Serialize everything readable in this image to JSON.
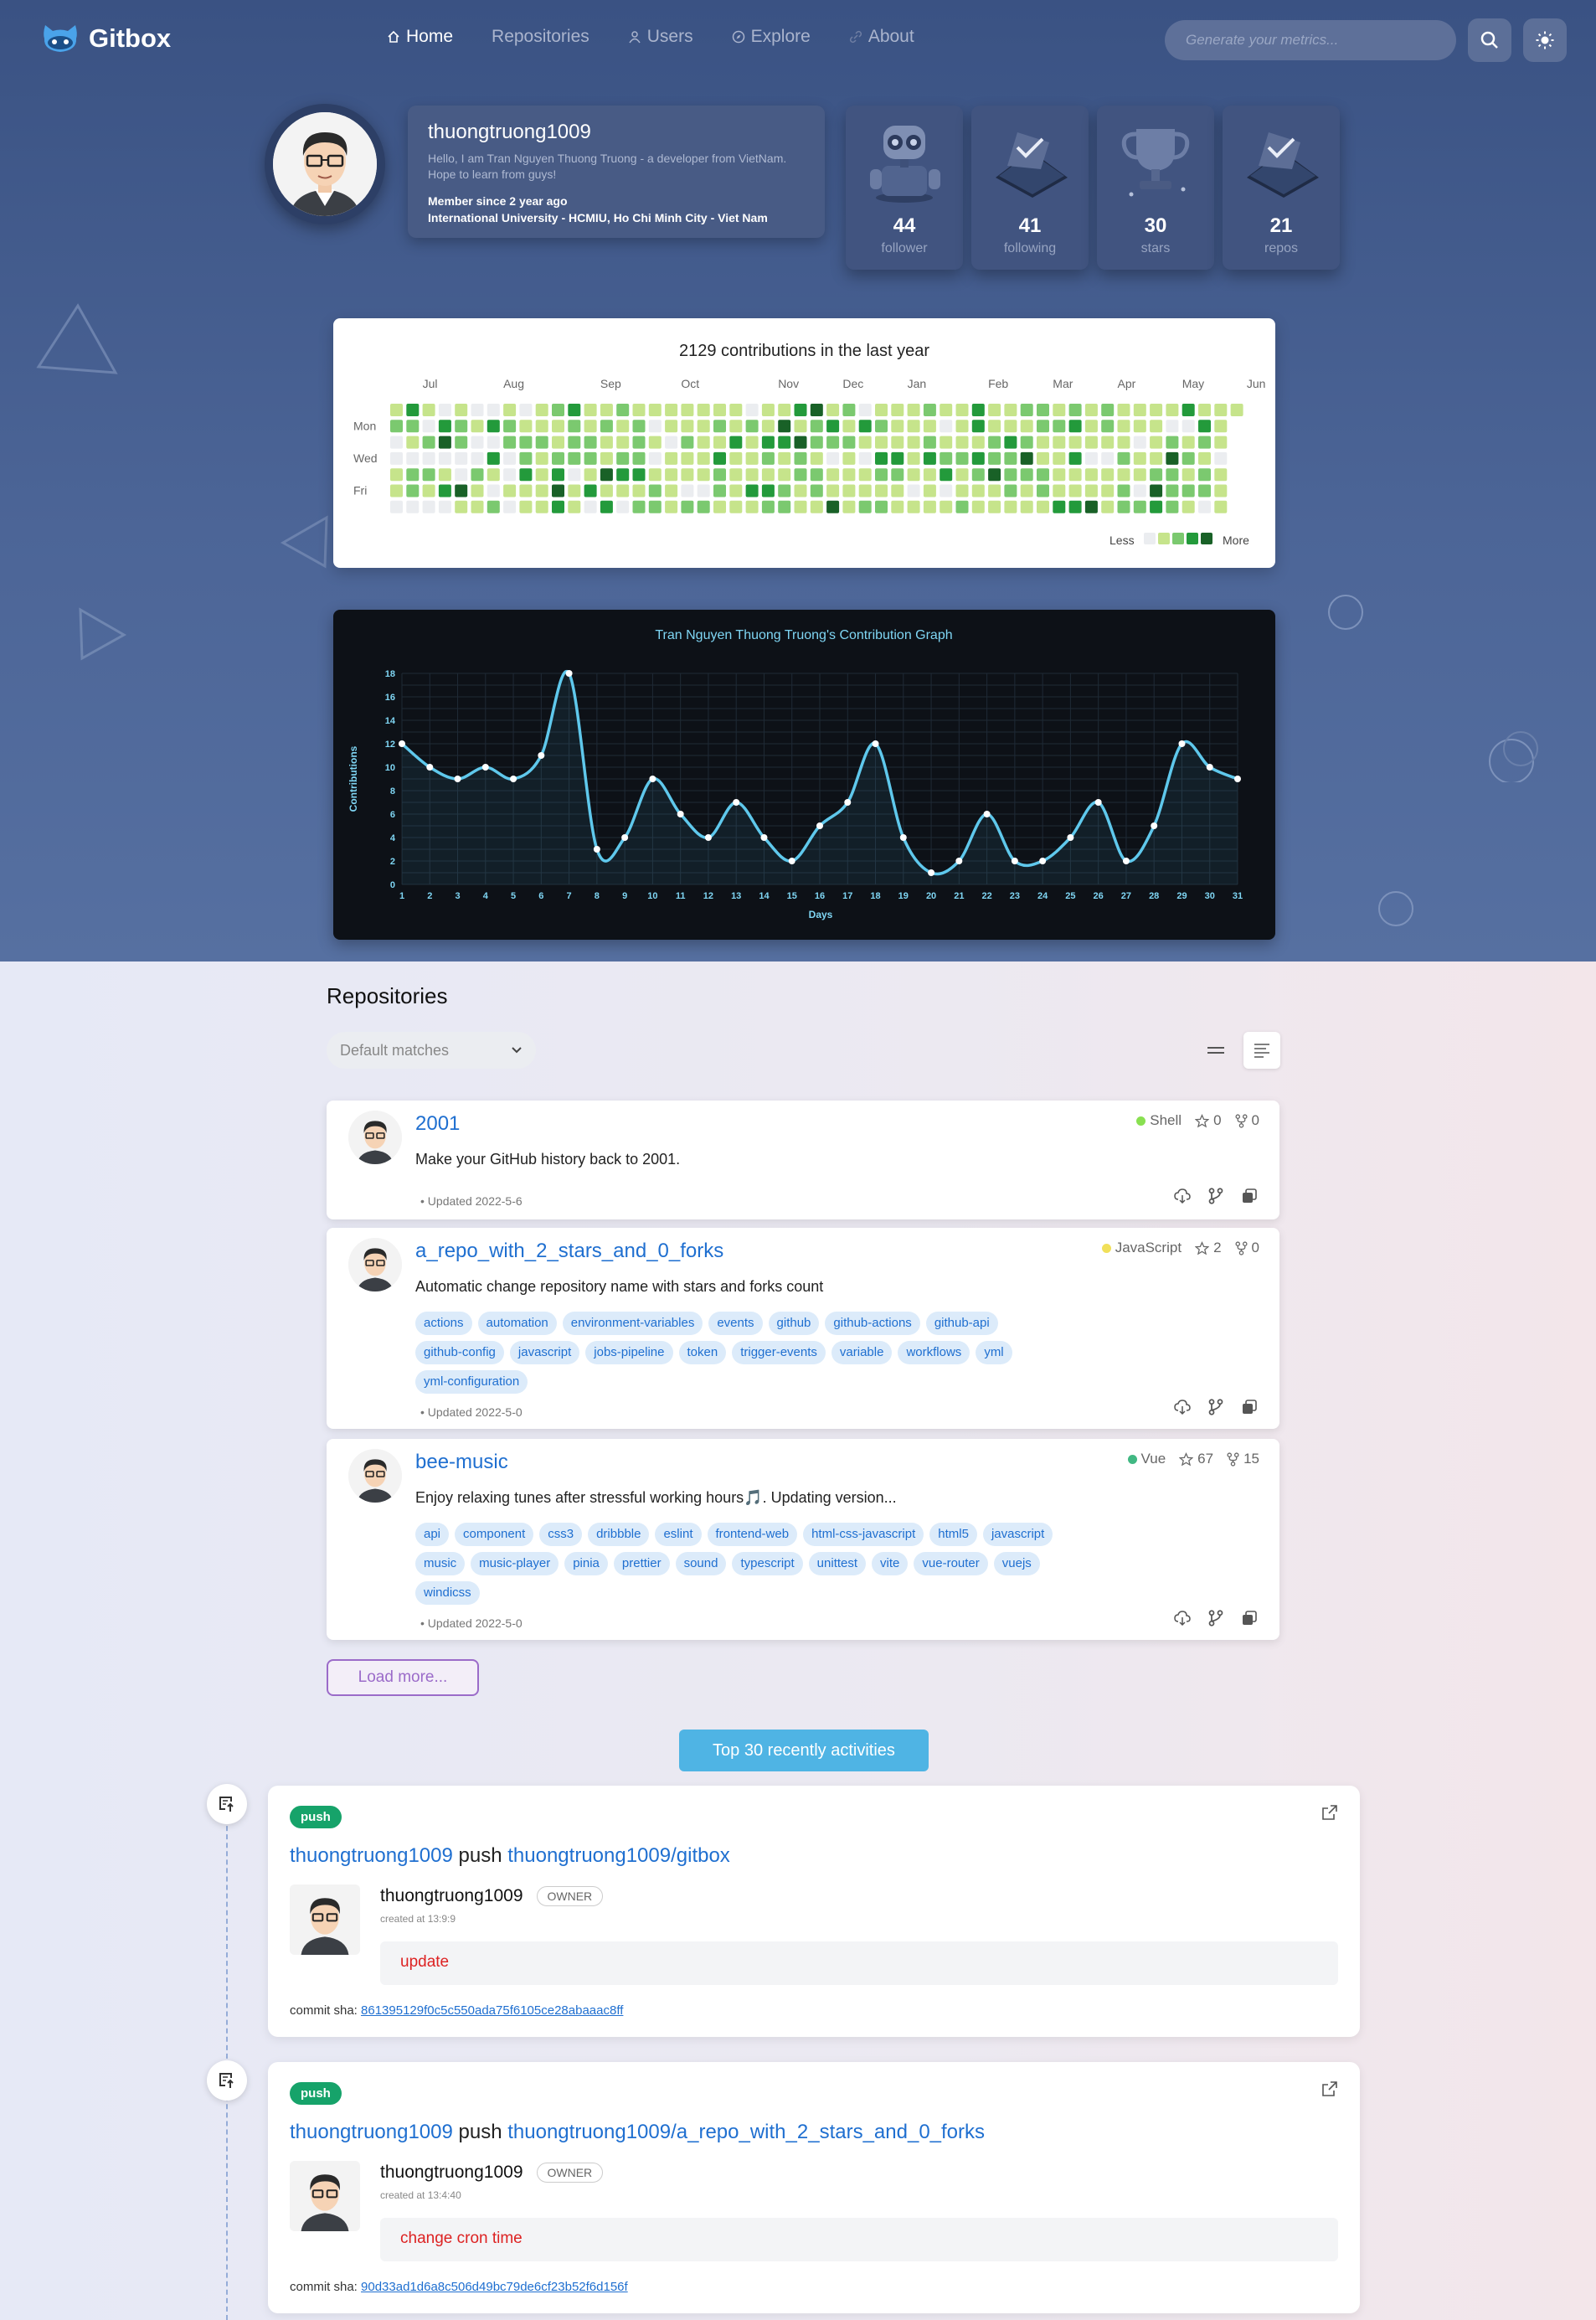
{
  "header": {
    "logo_text": "Gitbox",
    "nav": [
      {
        "label": "Home",
        "icon": "home-icon"
      },
      {
        "label": "Repositories",
        "icon": ""
      },
      {
        "label": "Users",
        "icon": "user-icon"
      },
      {
        "label": "Explore",
        "icon": "compass-icon"
      },
      {
        "label": "About",
        "icon": "link-icon"
      }
    ],
    "search_placeholder": "Generate your metrics..."
  },
  "profile": {
    "username": "thuongtruong1009",
    "bio": "Hello, I am Tran Nguyen Thuong Truong - a developer from VietNam. Hope to learn from guys!",
    "member_since": "Member since 2 year ago",
    "school": "International University - HCMIU, Ho Chi Minh City - Viet Nam",
    "stats": [
      {
        "value": "44",
        "label": "follower",
        "icon": "robot-icon"
      },
      {
        "value": "41",
        "label": "following",
        "icon": "laptop-icon"
      },
      {
        "value": "30",
        "label": "stars",
        "icon": "trophy-icon"
      },
      {
        "value": "21",
        "label": "repos",
        "icon": "laptop-icon"
      }
    ]
  },
  "contributions": {
    "title": "2129 contributions in the last year",
    "months": [
      "Jul",
      "Aug",
      "Sep",
      "Oct",
      "Nov",
      "Dec",
      "Jan",
      "Feb",
      "Mar",
      "Apr",
      "May",
      "Jun"
    ],
    "days": [
      "Mon",
      "Wed",
      "Fri"
    ],
    "legend_less": "Less",
    "legend_more": "More",
    "colors": [
      "#ebedf0",
      "#c6e48b",
      "#7bc96f",
      "#239a3b",
      "#196127"
    ]
  },
  "chart_data": {
    "type": "line",
    "title": "Tran Nguyen Thuong Truong's Contribution Graph",
    "xlabel": "Days",
    "ylabel": "Contributions",
    "x": [
      1,
      2,
      3,
      4,
      5,
      6,
      7,
      8,
      9,
      10,
      11,
      12,
      13,
      14,
      15,
      16,
      17,
      18,
      19,
      20,
      21,
      22,
      23,
      24,
      25,
      26,
      27,
      28,
      29,
      30,
      31
    ],
    "values": [
      12,
      10,
      9,
      10,
      9,
      11,
      18,
      3,
      4,
      9,
      6,
      4,
      7,
      4,
      2,
      5,
      7,
      12,
      4,
      1,
      2,
      6,
      2,
      2,
      4,
      7,
      2,
      5,
      12,
      10,
      9
    ],
    "yticks": [
      0,
      2,
      4,
      6,
      8,
      10,
      12,
      14,
      16,
      18
    ],
    "ylim": [
      0,
      18
    ],
    "grid": true,
    "line_color": "#5fc8ec"
  },
  "repositories": {
    "title": "Repositories",
    "sort_label": "Default matches",
    "load_more": "Load more...",
    "items": [
      {
        "name": "2001",
        "description": "Make your GitHub history back to 2001.",
        "language": "Shell",
        "lang_color": "#89e051",
        "stars": "0",
        "forks": "0",
        "tags": [],
        "updated": "Updated 2022-5-6"
      },
      {
        "name": "a_repo_with_2_stars_and_0_forks",
        "description": "Automatic change repository name with stars and forks count",
        "language": "JavaScript",
        "lang_color": "#f1e05a",
        "stars": "2",
        "forks": "0",
        "tags": [
          "actions",
          "automation",
          "environment-variables",
          "events",
          "github",
          "github-actions",
          "github-api",
          "github-config",
          "javascript",
          "jobs-pipeline",
          "token",
          "trigger-events",
          "variable",
          "workflows",
          "yml",
          "yml-configuration"
        ],
        "updated": "Updated 2022-5-0"
      },
      {
        "name": "bee-music",
        "description": "Enjoy relaxing tunes after stressful working hours🎵. Updating version...",
        "language": "Vue",
        "lang_color": "#41b883",
        "stars": "67",
        "forks": "15",
        "tags": [
          "api",
          "component",
          "css3",
          "dribbble",
          "eslint",
          "frontend-web",
          "html-css-javascript",
          "html5",
          "javascript",
          "music",
          "music-player",
          "pinia",
          "prettier",
          "sound",
          "typescript",
          "unittest",
          "vite",
          "vue-router",
          "vuejs",
          "windicss"
        ],
        "updated": "Updated 2022-5-0"
      }
    ]
  },
  "activities": {
    "title": "Top 30 recently activities",
    "items": [
      {
        "badge": "push",
        "actor": "thuongtruong1009",
        "verb": "push",
        "repo": "thuongtruong1009/gitbox",
        "user": "thuongtruong1009",
        "role": "OWNER",
        "created": "created at 13:9:9",
        "message": "update",
        "sha_label": "commit sha:",
        "sha": "861395129f0c5c550ada75f6105ce28abaaac8ff"
      },
      {
        "badge": "push",
        "actor": "thuongtruong1009",
        "verb": "push",
        "repo": "thuongtruong1009/a_repo_with_2_stars_and_0_forks",
        "user": "thuongtruong1009",
        "role": "OWNER",
        "created": "created at 13:4:40",
        "message": "change cron time",
        "sha_label": "commit sha:",
        "sha": "90d33ad1d6a8c506d49bc79de6cf23b52f6d156f"
      }
    ]
  }
}
